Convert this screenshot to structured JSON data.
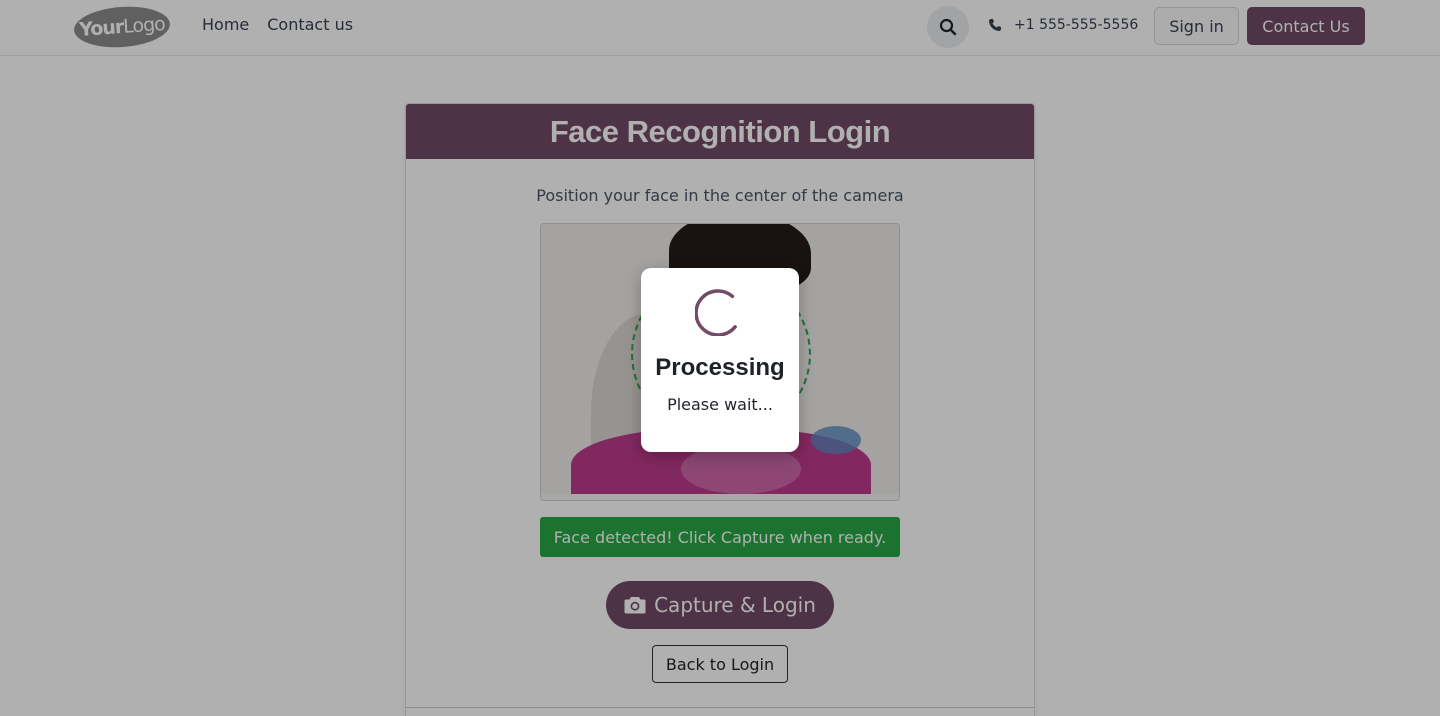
{
  "header": {
    "logo": {
      "part1": "Your",
      "part2": "Logo"
    },
    "nav": [
      {
        "label": "Home"
      },
      {
        "label": "Contact us"
      }
    ],
    "search_icon": "search-icon",
    "phone_icon": "phone-icon",
    "phone": "+1 555-555-5556",
    "signin_label": "Sign in",
    "contact_label": "Contact Us"
  },
  "card": {
    "title": "Face Recognition Login",
    "instruction": "Position your face in the center of the camera",
    "status_text": "Face detected! Click Capture when ready.",
    "capture_icon": "camera-icon",
    "capture_label": "Capture & Login",
    "back_label": "Back to Login"
  },
  "modal": {
    "title": "Processing",
    "subtitle": "Please wait..."
  },
  "colors": {
    "brand": "#714b67",
    "success": "#28a745",
    "face_guide": "#2ea44f"
  }
}
